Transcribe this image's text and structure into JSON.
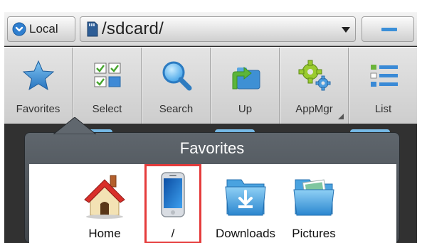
{
  "address_bar": {
    "local_label": "Local",
    "path": "/sdcard/"
  },
  "toolbar": {
    "items": [
      {
        "label": "Favorites",
        "icon": "star-icon"
      },
      {
        "label": "Select",
        "icon": "select-grid-icon"
      },
      {
        "label": "Search",
        "icon": "magnifier-icon"
      },
      {
        "label": "Up",
        "icon": "folder-up-icon"
      },
      {
        "label": "AppMgr",
        "icon": "gears-icon"
      },
      {
        "label": "List",
        "icon": "list-view-icon"
      }
    ]
  },
  "favorites": {
    "title": "Favorites",
    "items": [
      {
        "label": "Home",
        "icon": "house-icon"
      },
      {
        "label": "/",
        "icon": "phone-icon",
        "highlighted": true
      },
      {
        "label": "Downloads",
        "icon": "download-folder-icon"
      },
      {
        "label": "Pictures",
        "icon": "pictures-folder-icon"
      }
    ]
  },
  "colors": {
    "accent_blue": "#3b8fd8",
    "highlight_red": "#e53b3b",
    "popup_header": "#4d5358"
  }
}
